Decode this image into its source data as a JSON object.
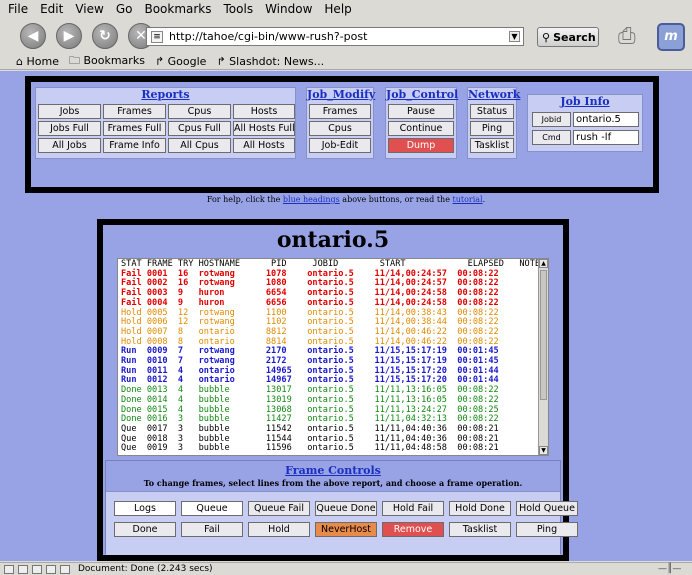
{
  "menu": {
    "items": [
      "File",
      "Edit",
      "View",
      "Go",
      "Bookmarks",
      "Tools",
      "Window",
      "Help"
    ]
  },
  "navbar": {
    "url": "http://tahoe/cgi-bin/www-rush?-post",
    "search_label": "Search"
  },
  "bookmarks": {
    "home": "Home",
    "bookmarks": "Bookmarks",
    "google": "Google",
    "slashdot": "Slashdot: News..."
  },
  "reports": {
    "heading": "Reports",
    "buttons": [
      "Jobs",
      "Frames",
      "Cpus",
      "Hosts",
      "Jobs Full",
      "Frames Full",
      "Cpus Full",
      "All Hosts Full",
      "All Jobs",
      "Frame Info",
      "All Cpus",
      "All Hosts"
    ]
  },
  "job_modify": {
    "heading": "Job_Modify",
    "buttons": [
      "Frames",
      "Cpus",
      "Job-Edit"
    ]
  },
  "job_control": {
    "heading": "Job_Control",
    "buttons": [
      "Pause",
      "Continue",
      "Dump"
    ]
  },
  "network": {
    "heading": "Network",
    "buttons": [
      "Status",
      "Ping",
      "Tasklist"
    ]
  },
  "job_info": {
    "heading": "Job Info",
    "jobid_label": "Jobid",
    "jobid_value": "ontario.5",
    "cmd_label": "Cmd",
    "cmd_value": "rush -lf"
  },
  "help": {
    "prefix": "For help, click the",
    "link1": "blue headings",
    "middle": "above buttons, or read the",
    "link2": "tutorial",
    "suffix": "."
  },
  "report": {
    "title": "ontario.5",
    "header": "STAT FRAME TRY HOSTNAME      PID     JOBID        START            ELAPSED   NOTES",
    "rows": [
      {
        "status": "fail",
        "text": "Fail 0001  16  rotwang      1078    ontario.5    11/14,00:24:57  00:08:22"
      },
      {
        "status": "fail",
        "text": "Fail 0002  16  rotwang      1080    ontario.5    11/14,00:24:57  00:08:22"
      },
      {
        "status": "fail",
        "text": "Fail 0003  9   huron        6654    ontario.5    11/14,00:24:58  00:08:22"
      },
      {
        "status": "fail",
        "text": "Fail 0004  9   huron        6656    ontario.5    11/14,00:24:58  00:08:22"
      },
      {
        "status": "hold",
        "text": "Hold 0005  12  rotwang      1100    ontario.5    11/14,00:38:43  00:08:22"
      },
      {
        "status": "hold",
        "text": "Hold 0006  12  rotwang      1102    ontario.5    11/14,00:38:44  00:08:22"
      },
      {
        "status": "hold",
        "text": "Hold 0007  8   ontario      8812    ontario.5    11/14,00:46:22  00:08:22"
      },
      {
        "status": "hold",
        "text": "Hold 0008  8   ontario      8814    ontario.5    11/14,00:46:22  00:08:22"
      },
      {
        "status": "run",
        "text": "Run  0009  7   rotwang      2170    ontario.5    11/15,15:17:19  00:01:45"
      },
      {
        "status": "run",
        "text": "Run  0010  7   rotwang      2172    ontario.5    11/15,15:17:19  00:01:45"
      },
      {
        "status": "run",
        "text": "Run  0011  4   ontario      14965   ontario.5    11/15,15:17:20  00:01:44"
      },
      {
        "status": "run",
        "text": "Run  0012  4   ontario      14967   ontario.5    11/15,15:17:20  00:01:44"
      },
      {
        "status": "done",
        "text": "Done 0013  4   bubble       13017   ontario.5    11/11,13:16:05  00:08:22"
      },
      {
        "status": "done",
        "text": "Done 0014  4   bubble       13019   ontario.5    11/11,13:16:05  00:08:22"
      },
      {
        "status": "done",
        "text": "Done 0015  4   bubble       13068   ontario.5    11/11,13:24:27  00:08:25"
      },
      {
        "status": "done",
        "text": "Done 0016  3   bubble       11427   ontario.5    11/11,04:32:13  00:08:22"
      },
      {
        "status": "que",
        "text": "Que  0017  3   bubble       11542   ontario.5    11/11,04:40:36  00:08:21"
      },
      {
        "status": "que",
        "text": "Que  0018  3   bubble       11544   ontario.5    11/11,04:40:36  00:08:21"
      },
      {
        "status": "que",
        "text": "Que  0019  3   bubble       11596   ontario.5    11/11,04:48:58  00:08:21"
      }
    ]
  },
  "frame_controls": {
    "heading": "Frame Controls",
    "help": "To change frames, select lines from the above report, and choose a frame operation.",
    "row1": [
      "Logs",
      "Queue",
      "Queue Fail",
      "Queue Done",
      "Hold Fail",
      "Hold Done",
      "Hold Queue"
    ],
    "row2": [
      "Done",
      "Fail",
      "Hold",
      "NeverHost",
      "Remove",
      "Tasklist",
      "Ping"
    ]
  },
  "status": {
    "text": "Document: Done (2.243 secs)"
  },
  "colors": {
    "page_bg": "#98a3e6",
    "heading_link": "#1a2fc0",
    "fail": "#e00000",
    "hold": "#e08a00",
    "run": "#1a1acc",
    "done": "#118811",
    "dump_button": "#e05050",
    "neverhost_button": "#e88a4a"
  }
}
